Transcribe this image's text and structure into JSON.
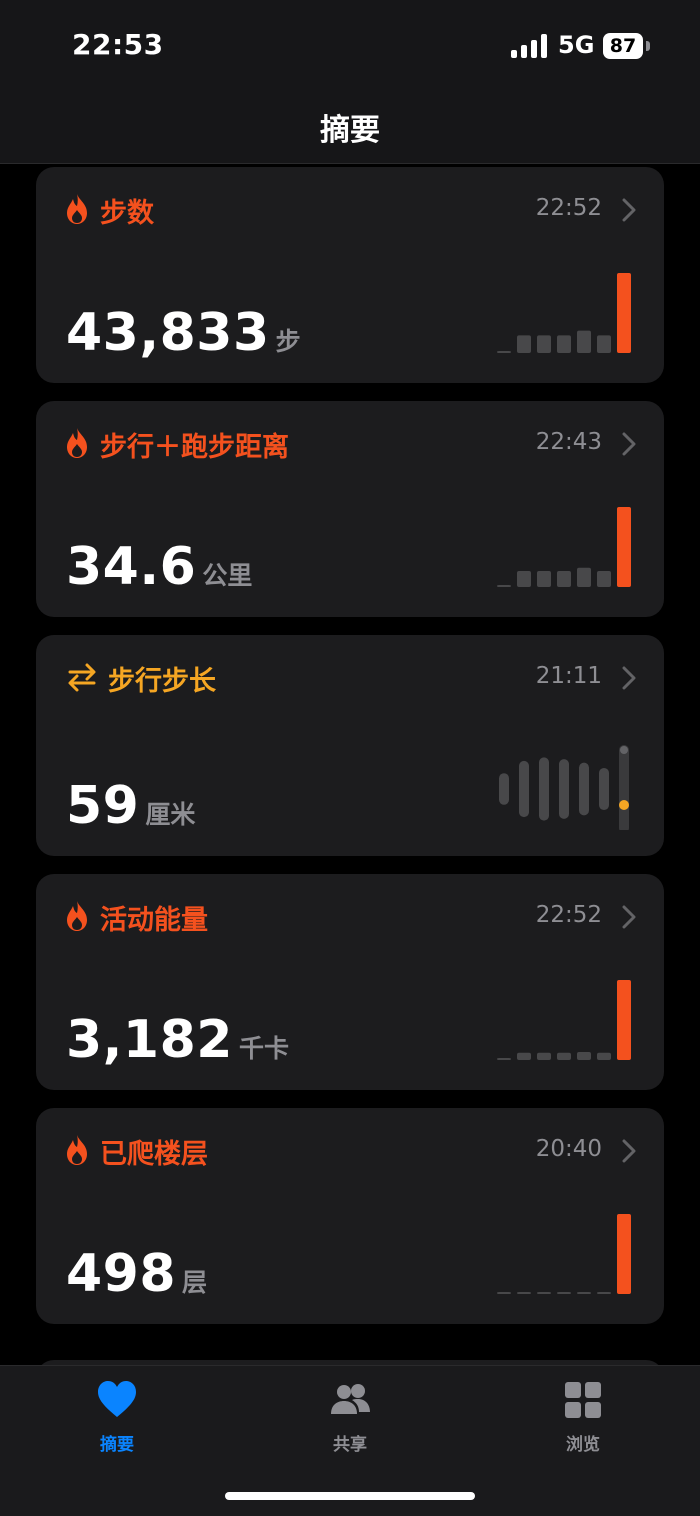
{
  "status_bar": {
    "time": "22:53",
    "network": "5G",
    "battery": "87"
  },
  "header": {
    "title": "摘要"
  },
  "colors": {
    "accent_orange": "#f4511e",
    "accent_amber": "#f5a623",
    "tab_active": "#0a84ff",
    "bar_inactive": "#48484a"
  },
  "cards": [
    {
      "title": "步数",
      "icon": "flame-icon",
      "time": "22:52",
      "value": "43,833",
      "unit": "步",
      "chart_data": {
        "type": "bar",
        "values": [
          0.02,
          0.22,
          0.22,
          0.22,
          0.28,
          0.22,
          1.0
        ]
      }
    },
    {
      "title": "步行＋跑步距离",
      "icon": "flame-icon",
      "time": "22:43",
      "value": "34.6",
      "unit": "公里",
      "chart_data": {
        "type": "bar",
        "values": [
          0.02,
          0.2,
          0.2,
          0.2,
          0.24,
          0.2,
          1.0
        ]
      }
    },
    {
      "title": "步行步长",
      "icon": "arrows-swap-icon",
      "time": "21:11",
      "value": "59",
      "unit": "厘米",
      "chart_data": {
        "type": "range",
        "values": [
          0.45,
          0.8,
          0.9,
          0.85,
          0.75,
          0.6,
          1.0
        ],
        "highlight_index": 6
      }
    },
    {
      "title": "活动能量",
      "icon": "flame-icon",
      "time": "22:52",
      "value": "3,182",
      "unit": "千卡",
      "chart_data": {
        "type": "bar",
        "values": [
          0.02,
          0.09,
          0.09,
          0.09,
          0.1,
          0.09,
          1.0
        ]
      }
    },
    {
      "title": "已爬楼层",
      "icon": "flame-icon",
      "time": "20:40",
      "value": "498",
      "unit": "层",
      "chart_data": {
        "type": "bar",
        "values": [
          0.02,
          0.02,
          0.02,
          0.02,
          0.02,
          0.02,
          1.0
        ]
      }
    }
  ],
  "tabs": [
    {
      "label": "摘要",
      "icon": "heart-icon",
      "active": true
    },
    {
      "label": "共享",
      "icon": "people-icon",
      "active": false
    },
    {
      "label": "浏览",
      "icon": "grid-icon",
      "active": false
    }
  ]
}
